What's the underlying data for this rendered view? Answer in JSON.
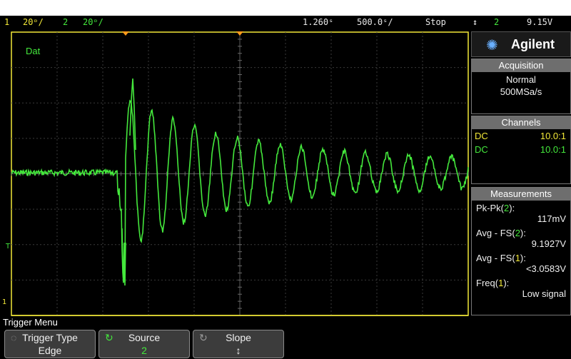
{
  "status_bar": {
    "ch1_num": "1",
    "ch1_scale": "20ᶛ/",
    "ch2_num": "2",
    "ch2_scale": "20ᶛ/",
    "time_delay": "1.260ˢ",
    "time_scale": "500.0ˢ/",
    "run_state": "Stop",
    "trigger_icon": "↕",
    "trigger_source": "2",
    "trigger_level": "9.15V"
  },
  "screen": {
    "channel_label": "Dat",
    "ground_marker_1": "T",
    "ground_marker_2": "1",
    "colors": {
      "ch1": "#f2e838",
      "ch2": "#44e83c",
      "grid": "#3a3a3a",
      "trigger_marker": "#ff9a1a"
    }
  },
  "sidebar": {
    "brand": "Agilent",
    "acquisition": {
      "title": "Acquisition",
      "mode": "Normal",
      "rate": "500MSa/s"
    },
    "channels": {
      "title": "Channels",
      "rows": [
        {
          "coupling": "DC",
          "probe": "10.0:1",
          "color": "#f2e838"
        },
        {
          "coupling": "DC",
          "probe": "10.0:1",
          "color": "#44e83c"
        }
      ]
    },
    "measurements": {
      "title": "Measurements",
      "items": [
        {
          "name": "Pk-Pk",
          "channel": "2",
          "value": "117mV",
          "channel_color": "#44e83c"
        },
        {
          "name": "Avg - FS",
          "channel": "2",
          "value": "9.1927V",
          "channel_color": "#44e83c"
        },
        {
          "name": "Avg - FS",
          "channel": "1",
          "value": "<3.0583V",
          "channel_color": "#f2e838"
        },
        {
          "name": "Freq",
          "channel": "1",
          "value": "Low signal",
          "channel_color": "#f2e838"
        }
      ]
    }
  },
  "softkeys": {
    "menu_title": "Trigger Menu",
    "keys": [
      {
        "label": "Trigger Type",
        "value": "Edge"
      },
      {
        "label": "Source",
        "value": "2"
      },
      {
        "label": "Slope",
        "value": "↕"
      }
    ]
  }
}
